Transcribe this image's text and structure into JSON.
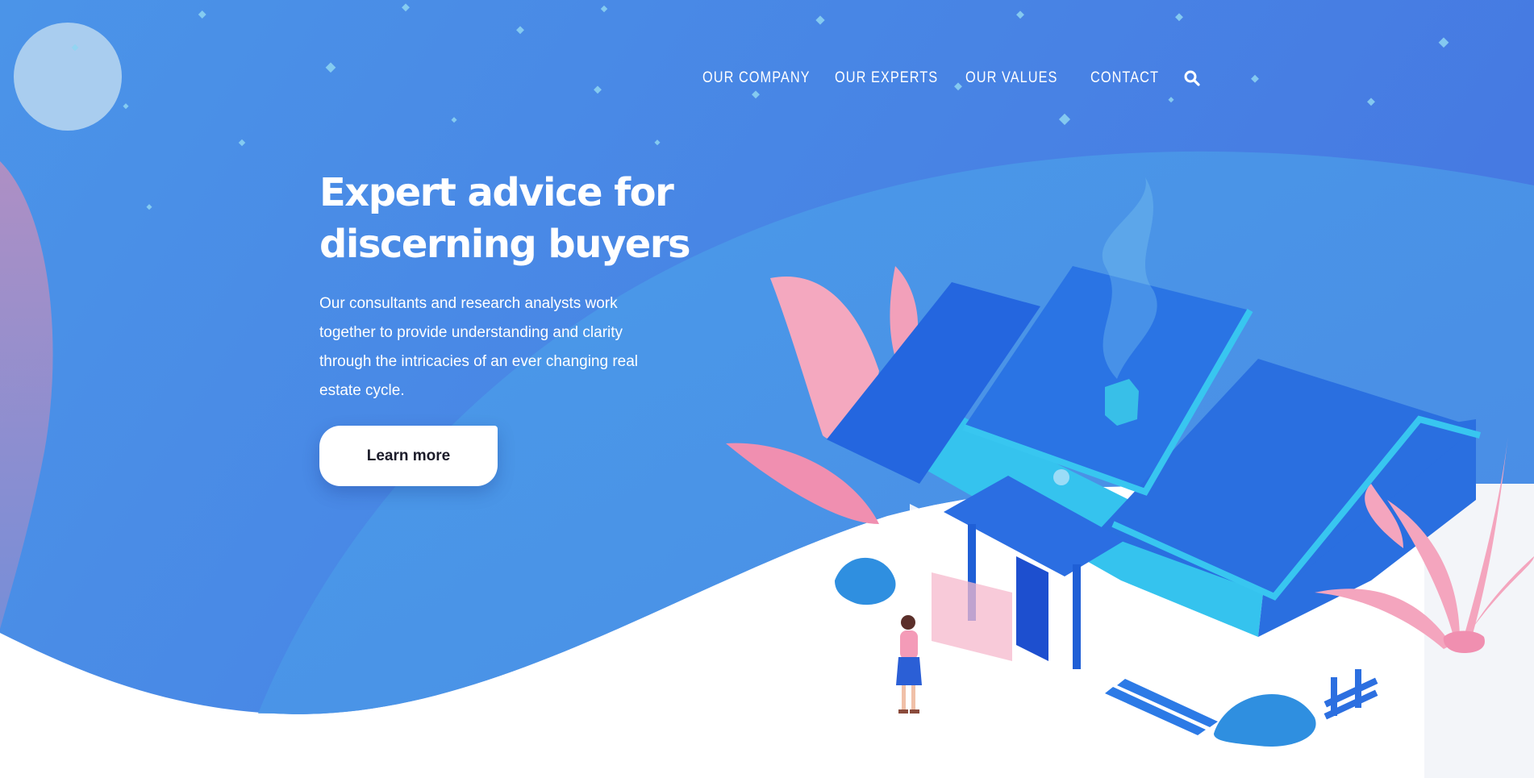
{
  "nav": {
    "items": [
      {
        "label": "OUR COMPANY"
      },
      {
        "label": "OUR EXPERTS"
      },
      {
        "label": "OUR VALUES"
      },
      {
        "label": "CONTACT"
      }
    ],
    "search_icon": "search-icon"
  },
  "hero": {
    "title": "Expert advice for\ndiscerning buyers",
    "description": "Our consultants and research analysts work together to provide understanding and clarity through the intricacies of an ever changing real estate cycle.",
    "cta_label": "Learn more"
  },
  "colors": {
    "background_top": "#4a8ee6",
    "background_wave": "#4a9ce8",
    "accent_pink": "#f4a5be",
    "house_roof": "#2a6fe0",
    "house_wall": "#35c3ee",
    "button_bg": "#ffffff",
    "text_light": "#ffffff"
  },
  "illustration": {
    "subject": "isometric house with plants and a woman standing in front"
  }
}
